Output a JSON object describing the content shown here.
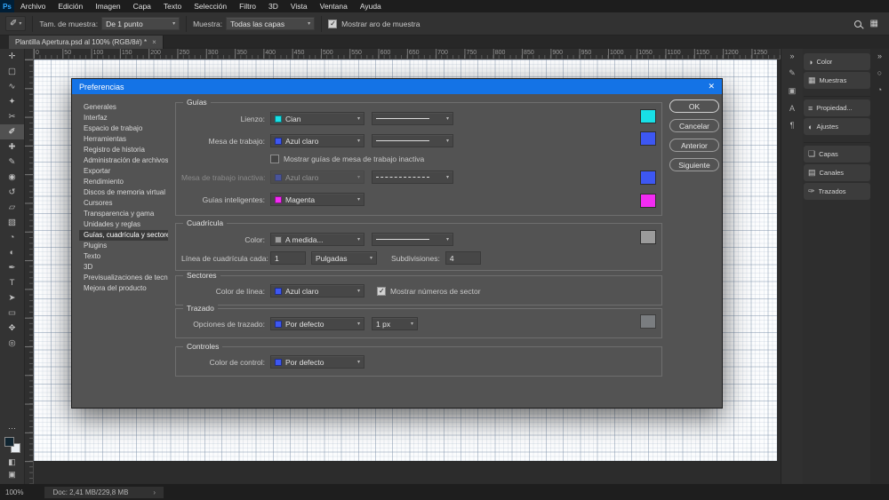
{
  "colors": {
    "accent_blue": "#1473e6",
    "cyan": "#18e0e6",
    "light_blue": "#3d57f2",
    "magenta": "#f32bf3",
    "custom_gray": "#9b9b9b",
    "stroke_muted": "#9aa0a6",
    "fg_color": "#0f2430",
    "bg_color": "#e9eef2"
  },
  "menubar": {
    "logo": "Ps",
    "items": [
      {
        "label": "Archivo"
      },
      {
        "label": "Edición"
      },
      {
        "label": "Imagen"
      },
      {
        "label": "Capa"
      },
      {
        "label": "Texto"
      },
      {
        "label": "Selección"
      },
      {
        "label": "Filtro"
      },
      {
        "label": "3D"
      },
      {
        "label": "Vista"
      },
      {
        "label": "Ventana"
      },
      {
        "label": "Ayuda"
      }
    ]
  },
  "options": {
    "tool_glyph": "✐",
    "sample_size_label": "Tam. de muestra:",
    "sample_size_value": "De 1 punto",
    "sample_label": "Muestra:",
    "sample_value": "Todas las capas",
    "show_ring_label": "Mostrar aro de muestra",
    "workspace_icon_glyph": "▦"
  },
  "tab": {
    "title": "Plantilla Apertura.psd al 100% (RGB/8#) *",
    "close": "×"
  },
  "ruler_numbers": [
    "0",
    "50",
    "100",
    "150",
    "200",
    "250",
    "300",
    "350",
    "400",
    "450",
    "500",
    "550",
    "600",
    "650",
    "700",
    "750",
    "800",
    "850",
    "900",
    "950",
    "1000",
    "1050",
    "1100",
    "1150",
    "1200",
    "1250"
  ],
  "tools": [
    {
      "name": "move-tool",
      "glyph": "✛"
    },
    {
      "name": "marquee-tool",
      "glyph": "▢"
    },
    {
      "name": "lasso-tool",
      "glyph": "∿"
    },
    {
      "name": "magic-wand-tool",
      "glyph": "✦"
    },
    {
      "name": "crop-tool",
      "glyph": "✂"
    },
    {
      "name": "eyedropper-tool",
      "glyph": "✐",
      "selected": true
    },
    {
      "name": "healing-brush-tool",
      "glyph": "✚"
    },
    {
      "name": "brush-tool",
      "glyph": "✎"
    },
    {
      "name": "clone-stamp-tool",
      "glyph": "◉"
    },
    {
      "name": "history-brush-tool",
      "glyph": "↺"
    },
    {
      "name": "eraser-tool",
      "glyph": "▱"
    },
    {
      "name": "gradient-tool",
      "glyph": "▧"
    },
    {
      "name": "blur-tool",
      "glyph": "◔"
    },
    {
      "name": "dodge-tool",
      "glyph": "◐"
    },
    {
      "name": "pen-tool",
      "glyph": "✒"
    },
    {
      "name": "type-tool",
      "glyph": "T"
    },
    {
      "name": "path-selection-tool",
      "glyph": "➤"
    },
    {
      "name": "shape-tool",
      "glyph": "▭"
    },
    {
      "name": "hand-tool",
      "glyph": "✥"
    },
    {
      "name": "zoom-tool",
      "glyph": "◎"
    }
  ],
  "toolbar_extras": {
    "more": "⋯",
    "quick_mask": "◧",
    "screen_mode": "▣"
  },
  "dialog": {
    "title": "Preferencias",
    "close": "✕",
    "nav": [
      {
        "label": "Generales"
      },
      {
        "label": "Interfaz"
      },
      {
        "label": "Espacio de trabajo"
      },
      {
        "label": "Herramientas"
      },
      {
        "label": "Registro de historia"
      },
      {
        "label": "Administración de archivos"
      },
      {
        "label": "Exportar"
      },
      {
        "label": "Rendimiento"
      },
      {
        "label": "Discos de memoria virtual"
      },
      {
        "label": "Cursores"
      },
      {
        "label": "Transparencia y gama"
      },
      {
        "label": "Unidades y reglas"
      },
      {
        "label": "Guías, cuadrícula y sectores",
        "selected": true
      },
      {
        "label": "Plugins"
      },
      {
        "label": "Texto"
      },
      {
        "label": "3D"
      },
      {
        "label": "Previsualizaciones de tecnología"
      },
      {
        "label": "Mejora del producto"
      }
    ],
    "buttons": {
      "ok": "OK",
      "cancel": "Cancelar",
      "prev": "Anterior",
      "next": "Siguiente"
    },
    "guides": {
      "legend": "Guías",
      "canvas": {
        "label": "Lienzo:",
        "value": "Cian",
        "color": "#18e0e6"
      },
      "artboard": {
        "label": "Mesa de trabajo:",
        "value": "Azul claro",
        "color": "#3d57f2"
      },
      "show_inactive_label": "Mostrar guías de mesa de trabajo inactiva",
      "inactive": {
        "label": "Mesa de trabajo inactiva:",
        "value": "Azul claro",
        "color": "#3d57f2"
      },
      "smart": {
        "label": "Guías inteligentes:",
        "value": "Magenta",
        "color": "#f32bf3"
      }
    },
    "grid": {
      "legend": "Cuadrícula",
      "color": {
        "label": "Color:",
        "value": "A medida...",
        "color": "#9b9b9b"
      },
      "line_every": {
        "label": "Línea de cuadrícula cada:",
        "value": "1",
        "unit": "Pulgadas"
      },
      "subdivisions": {
        "label": "Subdivisiones:",
        "value": "4"
      }
    },
    "slices": {
      "legend": "Sectores",
      "line_color": {
        "label": "Color de línea:",
        "value": "Azul claro",
        "color": "#3d57f2"
      },
      "show_numbers_label": "Mostrar números de sector"
    },
    "path": {
      "legend": "Trazado",
      "options": {
        "label": "Opciones de trazado:",
        "value": "Por defecto",
        "color": "#3d57f2"
      },
      "width_value": "1 px"
    },
    "controls": {
      "legend": "Controles",
      "color": {
        "label": "Color de control:",
        "value": "Por defecto",
        "color": "#3d57f2"
      }
    },
    "well_colors": {
      "canvas": "#18e0e6",
      "artboard": "#3d57f2",
      "inactive": "#3d57f2",
      "smart": "#f32bf3",
      "grid": "#9b9b9b",
      "stroke": "#9aa0a6"
    }
  },
  "panels": {
    "collapse_glyph": "»",
    "mini_icons": [
      {
        "name": "brushes-panel-icon",
        "glyph": "✎"
      },
      {
        "name": "clone-source-panel-icon",
        "glyph": "▣"
      },
      {
        "name": "character-panel-icon",
        "glyph": "A"
      },
      {
        "name": "paragraph-panel-icon",
        "glyph": "¶"
      }
    ],
    "group1": [
      {
        "name": "color-panel-button",
        "icon": "◑",
        "label": "Color"
      },
      {
        "name": "swatches-panel-button",
        "icon": "▦",
        "label": "Muestras"
      }
    ],
    "group2": [
      {
        "name": "properties-panel-button",
        "icon": "≡",
        "label": "Propiedad..."
      },
      {
        "name": "adjustments-panel-button",
        "icon": "◐",
        "label": "Ajustes"
      }
    ],
    "group3": [
      {
        "name": "layers-panel-button",
        "icon": "❏",
        "label": "Capas"
      },
      {
        "name": "channels-panel-button",
        "icon": "▤",
        "label": "Canales"
      },
      {
        "name": "paths-panel-button",
        "icon": "✑",
        "label": "Trazados"
      }
    ],
    "right_icons": [
      {
        "name": "libraries-panel-icon",
        "glyph": "○"
      },
      {
        "name": "history-panel-icon",
        "glyph": "◔"
      }
    ]
  },
  "statusbar": {
    "zoom": "100%",
    "doc_info": "Doc: 2,41 MB/229,8 MB",
    "chevron": "›"
  }
}
